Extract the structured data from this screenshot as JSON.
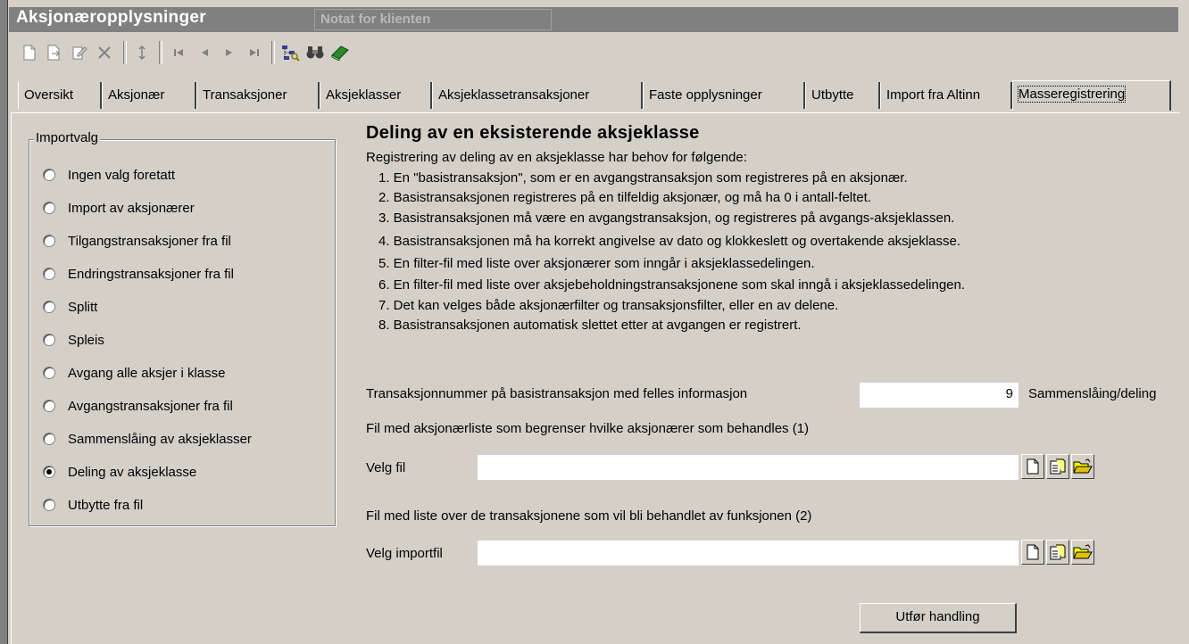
{
  "window": {
    "title": "Aksjonæropplysninger",
    "notat_label": "Notat for klienten"
  },
  "toolbar": {
    "icons": [
      "new-icon",
      "import-icon",
      "edit-icon",
      "delete-icon",
      "refresh-icon",
      "first-record-icon",
      "previous-record-icon",
      "next-record-icon",
      "last-record-icon",
      "tree-search-icon",
      "binoculars-icon",
      "book-icon"
    ]
  },
  "tabs": [
    {
      "label": "Oversikt"
    },
    {
      "label": "Aksjonær"
    },
    {
      "label": "Transaksjoner"
    },
    {
      "label": "Aksjeklasser"
    },
    {
      "label": "Aksjeklassetransaksjoner"
    },
    {
      "label": "Faste opplysninger"
    },
    {
      "label": "Utbytte"
    },
    {
      "label": "Import fra Altinn"
    },
    {
      "label": "Masseregistrering"
    }
  ],
  "active_tab": "Masseregistrering",
  "import_options": {
    "group_label": "Importvalg",
    "items": [
      {
        "label": "Ingen valg foretatt",
        "checked": false
      },
      {
        "label": "Import av aksjonærer",
        "checked": false
      },
      {
        "label": "Tilgangstransaksjoner fra fil",
        "checked": false
      },
      {
        "label": "Endringstransaksjoner fra fil",
        "checked": false
      },
      {
        "label": "Splitt",
        "checked": false
      },
      {
        "label": "Spleis",
        "checked": false
      },
      {
        "label": "Avgang alle aksjer i klasse",
        "checked": false
      },
      {
        "label": "Avgangstransaksjoner fra fil",
        "checked": false
      },
      {
        "label": "Sammenslåing av aksjeklasser",
        "checked": false
      },
      {
        "label": "Deling av aksjeklasse",
        "checked": true
      },
      {
        "label": "Utbytte fra fil",
        "checked": false
      }
    ]
  },
  "description": {
    "heading": "Deling av en eksisterende aksjeklasse",
    "intro": "Registrering av deling av en aksjeklasse har behov for følgende:",
    "steps": [
      "1. En \"basistransaksjon\", som er en avgangstransaksjon som registreres på en aksjonær.",
      "2. Basistransaksjonen registreres på en tilfeldig aksjonær, og må ha 0 i antall-feltet.",
      "3. Basistransaksjonen må være en avgangstransaksjon, og registreres på avgangs-aksjeklassen.",
      "4. Basistransaksjonen må ha korrekt angivelse av dato og klokkeslett og overtakende aksjeklasse.",
      "5. En filter-fil med liste over aksjonærer som inngår i aksjeklassedelingen.",
      "6. En filter-fil med liste over aksjebeholdningstransaksjonene som skal inngå i aksjeklassedelingen.",
      "7. Det kan velges både aksjonærfilter og transaksjonsfilter, eller en av delene.",
      "8. Basistransaksjonen automatisk slettet etter at avgangen er registrert."
    ]
  },
  "form": {
    "trans_label": "Transaksjonnummer på basistransaksjon med felles informasjon",
    "trans_value": "9",
    "trans_type": "Sammenslåing/deling",
    "file1_description": "Fil med aksjonærliste som begrenser hvilke aksjonærer som behandles (1)",
    "file1_label": "Velg fil",
    "file1_value": "",
    "file2_description": "Fil med liste over de transaksjonene som vil bli behandlet av funksjonen (2)",
    "file2_label": "Velg importfil",
    "file2_value": "",
    "run_button": "Utfør handling"
  }
}
